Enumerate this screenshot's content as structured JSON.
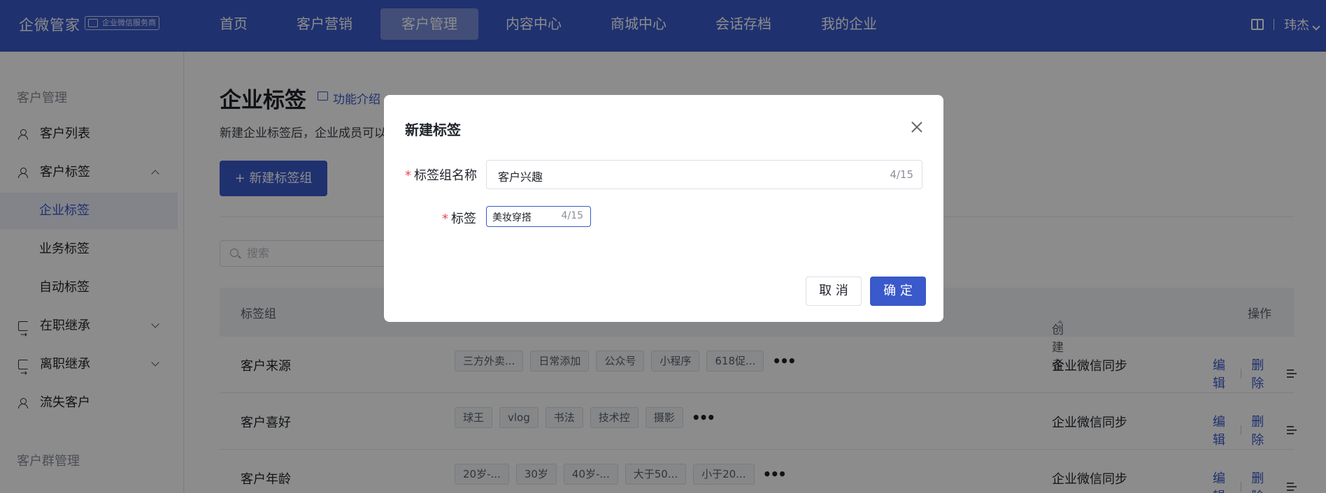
{
  "topbar": {
    "brand": "企微管家",
    "badge": "企业微信服务商",
    "nav": [
      "首页",
      "客户营销",
      "客户管理",
      "内容中心",
      "商城中心",
      "会话存档",
      "我的企业"
    ],
    "active_nav": "客户管理",
    "user": "玮杰"
  },
  "sidebar": {
    "group1": "客户管理",
    "items": [
      {
        "label": "客户列表"
      },
      {
        "label": "客户标签"
      },
      {
        "label": "企业标签"
      },
      {
        "label": "业务标签"
      },
      {
        "label": "自动标签"
      },
      {
        "label": "在职继承"
      },
      {
        "label": "离职继承"
      },
      {
        "label": "流失客户"
      }
    ],
    "group2": "客户群管理"
  },
  "main": {
    "title": "企业标签",
    "intro_link": "功能介绍",
    "desc": "新建企业标签后，企业成员可以",
    "new_group_button": "+ 新建标签组",
    "search_placeholder": "搜索",
    "columns": {
      "group": "标签组",
      "creator": "创建者",
      "ops": "操作"
    },
    "rows": [
      {
        "name": "客户来源",
        "tags": [
          "三方外卖...",
          "日常添加",
          "公众号",
          "小程序",
          "618促..."
        ],
        "creator": "企业微信同步"
      },
      {
        "name": "客户喜好",
        "tags": [
          "球王",
          "vlog",
          "书法",
          "技术控",
          "摄影"
        ],
        "creator": "企业微信同步"
      },
      {
        "name": "客户年龄",
        "tags": [
          "20岁-...",
          "30岁",
          "40岁-...",
          "大于50...",
          "小于20..."
        ],
        "creator": "企业微信同步"
      }
    ],
    "edit_label": "编辑",
    "delete_label": "删除"
  },
  "modal": {
    "title": "新建标签",
    "group_name_label": "标签组名称",
    "group_name_value": "客户兴趣",
    "group_name_counter": "4/15",
    "tag_label": "标签",
    "tag_value": "美妆穿搭",
    "tag_counter": "4/15",
    "cancel_label": "取 消",
    "ok_label": "确 定"
  },
  "colors": {
    "brand": "#3a59ca",
    "required": "#e5484d"
  }
}
